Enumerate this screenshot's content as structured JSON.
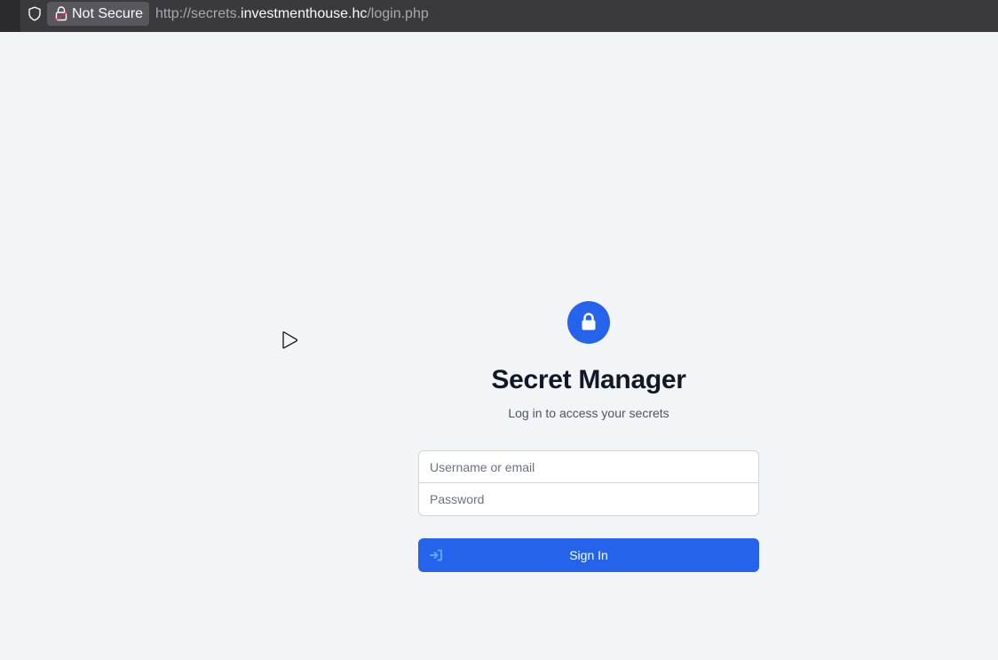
{
  "browser": {
    "security_label": "Not Secure",
    "url": {
      "prefix": "http://secrets.",
      "host": "investmenthouse.hc",
      "path": "/login.php"
    },
    "icons": {
      "shield": "shield-icon",
      "lock_warning": "lock-warning-icon"
    }
  },
  "page": {
    "stray_icon": "play-icon",
    "badge_icon": "lock-icon",
    "title": "Secret Manager",
    "subtitle": "Log in to access your secrets",
    "form": {
      "username_placeholder": "Username or email",
      "username_value": "",
      "password_placeholder": "Password",
      "password_value": ""
    },
    "signin": {
      "label": "Sign In",
      "icon": "sign-in-icon"
    }
  },
  "colors": {
    "page_background": "#f3f4f6",
    "accent": "#2563eb",
    "title": "#111827",
    "subtitle": "#4b5563",
    "input_border": "#d1d5db",
    "browser_bar": "#3a3a3d"
  }
}
